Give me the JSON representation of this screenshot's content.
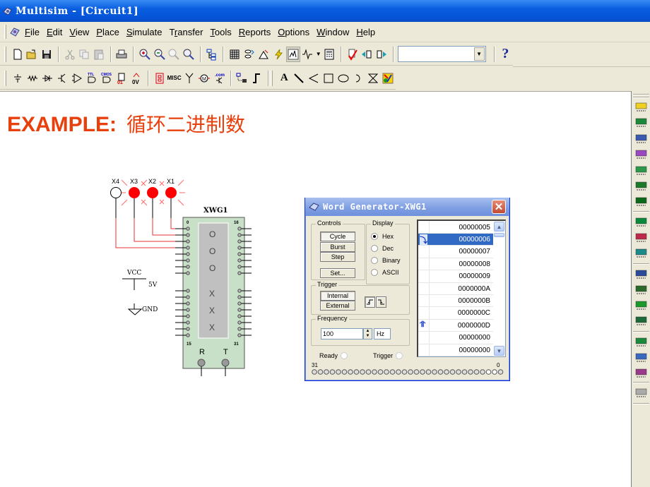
{
  "window": {
    "title": "Multisim - [Circuit1]"
  },
  "menu": {
    "items": [
      {
        "label": "File",
        "key": "F"
      },
      {
        "label": "Edit",
        "key": "E"
      },
      {
        "label": "View",
        "key": "V"
      },
      {
        "label": "Place",
        "key": "P"
      },
      {
        "label": "Simulate",
        "key": "S"
      },
      {
        "label": "Transfer",
        "key": "r"
      },
      {
        "label": "Tools",
        "key": "T"
      },
      {
        "label": "Reports",
        "key": "R"
      },
      {
        "label": "Options",
        "key": "O"
      },
      {
        "label": "Window",
        "key": "W"
      },
      {
        "label": "Help",
        "key": "H"
      }
    ]
  },
  "toolbar1": {
    "buttons": [
      "new-icon",
      "open-icon",
      "save-icon",
      "cut-icon",
      "copy-icon",
      "paste-icon",
      "print-icon",
      "zoom-in-icon",
      "zoom-out-icon",
      "zoom-area-icon",
      "zoom-fit-icon",
      "hierarchy-icon",
      "spreadsheet-icon",
      "database-icon",
      "component-wizard-icon",
      "run-icon",
      "grapher-icon",
      "analysis-icon",
      "postprocessor-icon",
      "erc-icon",
      "back-annotate-icon",
      "forward-annotate-icon"
    ],
    "in_use_list_value": "",
    "help_label": "?"
  },
  "toolbar2": {
    "components": [
      "source-icon",
      "basic-icon",
      "diode-icon",
      "transistor-icon",
      "analog-icon",
      "ttl-icon",
      "cmos-icon",
      "mixed-icon",
      "indicator-icon",
      "misc-digital-icon",
      "misc-icon",
      "rf-icon",
      "electromech-icon",
      "edaparts-icon",
      "bus-icon",
      "hier-block-icon"
    ],
    "misc_label": "MISC",
    "ttl_label": "TTL",
    "cmos_label": "CMOS",
    "com_label": ".com",
    "graphics": [
      "text-icon",
      "line-icon",
      "polyline-icon",
      "rectangle-icon",
      "ellipse-icon",
      "arc-icon",
      "polygon-icon",
      "picture-icon"
    ],
    "text_label": "A"
  },
  "headline": {
    "en": "EXAMPLE:",
    "zh": "循环二进制数"
  },
  "colors": {
    "headline": "#e8400c",
    "title_blue": "#0554d8",
    "wire_red": "#e53030",
    "probe_red": "#ff0000",
    "wg_body": "#c8e0c8"
  },
  "schematic": {
    "probes": [
      {
        "label": "X4",
        "lit": false
      },
      {
        "label": "X3",
        "lit": true
      },
      {
        "label": "X2",
        "lit": true
      },
      {
        "label": "X1",
        "lit": true
      }
    ],
    "xwg": {
      "name": "XWG1",
      "pin_top_left": "0",
      "pin_top_right": "16",
      "pin_bottom_left": "15",
      "pin_bottom_right": "31",
      "marks": [
        "O",
        "O",
        "O",
        "X",
        "X",
        "X"
      ],
      "pin_r": "R",
      "pin_t": "T"
    },
    "vcc": {
      "label": "VCC",
      "value": "5V"
    },
    "gnd": {
      "label": "GND"
    }
  },
  "word_generator": {
    "title": "Word Generator-XWG1",
    "controls": {
      "label": "Controls",
      "buttons": [
        "Cycle",
        "Burst",
        "Step"
      ],
      "set": "Set...",
      "active": "Cycle"
    },
    "display": {
      "label": "Display",
      "options": [
        "Hex",
        "Dec",
        "Binary",
        "ASCII"
      ],
      "selected": "Hex"
    },
    "trigger": {
      "label": "Trigger",
      "buttons": [
        "Internal",
        "External"
      ],
      "active": "Internal"
    },
    "frequency": {
      "label": "Frequency",
      "value": "100",
      "unit": "Hz"
    },
    "status": {
      "ready": "Ready",
      "trigger": "Trigger"
    },
    "bus": {
      "left": "31",
      "right": "0"
    },
    "words": [
      {
        "value": "00000005",
        "marker": ""
      },
      {
        "value": "00000006",
        "marker": "start",
        "selected": true
      },
      {
        "value": "00000007",
        "marker": ""
      },
      {
        "value": "00000008",
        "marker": ""
      },
      {
        "value": "00000009",
        "marker": ""
      },
      {
        "value": "0000000A",
        "marker": ""
      },
      {
        "value": "0000000B",
        "marker": ""
      },
      {
        "value": "0000000C",
        "marker": ""
      },
      {
        "value": "0000000D",
        "marker": "final"
      },
      {
        "value": "00000000",
        "marker": ""
      },
      {
        "value": "00000000",
        "marker": ""
      }
    ]
  },
  "instruments": [
    "multimeter-icon",
    "function-generator-icon",
    "wattmeter-icon",
    "oscilloscope-icon",
    "4ch-oscilloscope-icon",
    "bode-plotter-icon",
    "frequency-counter-icon",
    "word-generator-icon",
    "logic-analyzer-icon",
    "logic-converter-icon",
    "iv-analyzer-icon",
    "distortion-analyzer-icon",
    "spectrum-analyzer-icon",
    "network-analyzer-icon",
    "agilent-function-generator-icon",
    "agilent-multimeter-icon",
    "agilent-oscilloscope-icon",
    "tektronix-probe-icon"
  ]
}
